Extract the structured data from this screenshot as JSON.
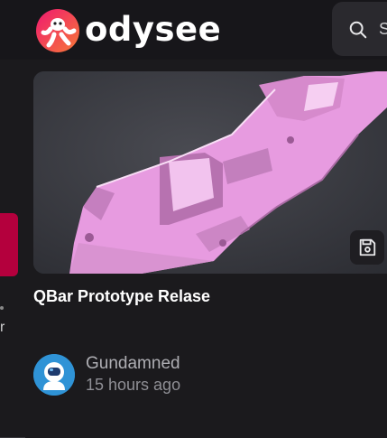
{
  "header": {
    "logo_text": "odysee",
    "search": {
      "placeholder": "S"
    }
  },
  "video": {
    "title": "QBar Prototype Relase",
    "channel": "Gundamned",
    "posted": "15 hours ago"
  },
  "left_rail": {
    "partial_char": "r"
  },
  "colors": {
    "background": "#1b1a1d",
    "accent": "#b4003d",
    "thumbnail_part": "#e79be0",
    "avatar": "#2f93d6"
  },
  "icons": [
    "odysee-logo-icon",
    "search-icon",
    "save-icon"
  ]
}
